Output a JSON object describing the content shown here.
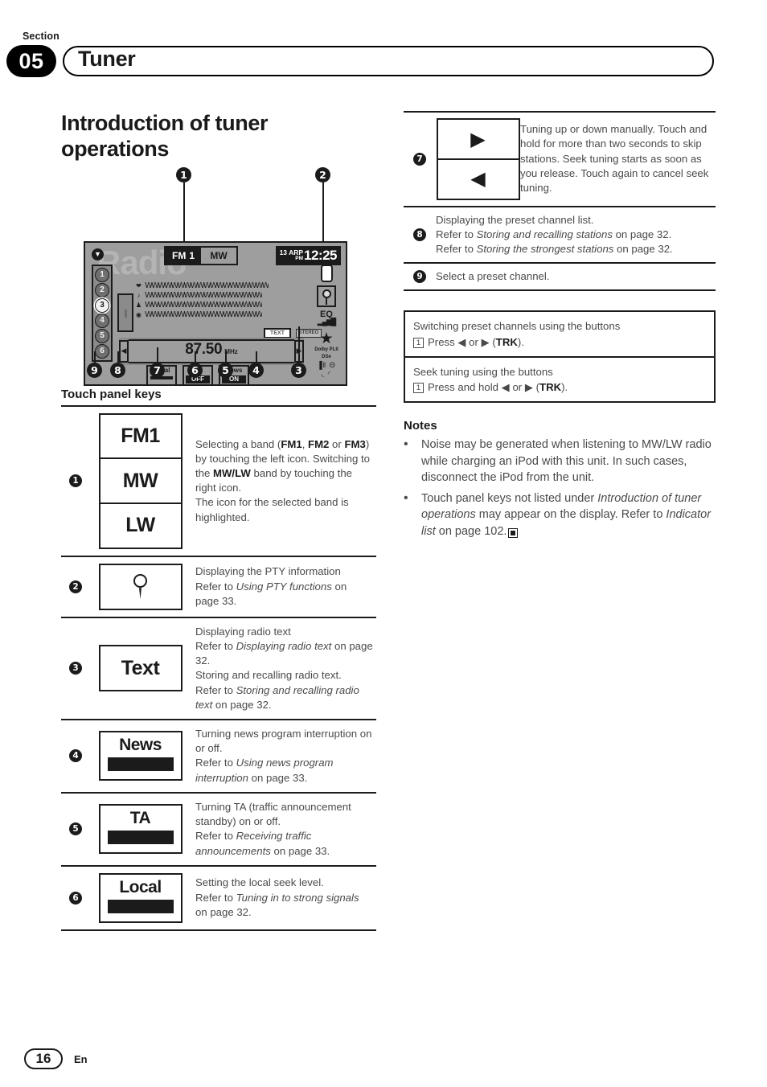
{
  "header": {
    "section_label": "Section",
    "section_number": "05",
    "title": "Tuner"
  },
  "page_heading": "Introduction of tuner operations",
  "diagram": {
    "callouts": [
      "1",
      "2",
      "3",
      "4",
      "5",
      "6",
      "7",
      "8",
      "9"
    ],
    "watermark": "Radio",
    "chevron_icon": "chevron-down-icon",
    "band": {
      "fm_label": "FM",
      "fm_number": "1",
      "mw_label": "MW"
    },
    "clock": {
      "date": "13 ARP",
      "meridiem": "PM",
      "time": "12:25"
    },
    "presets": [
      "1",
      "2",
      "3",
      "4",
      "5",
      "6"
    ],
    "preset_selected": "3",
    "text_lines": [
      "WWWWWWWWWWWWWWWWWWW",
      "WWWWWWWWWWWWWWWWWW",
      "WWWWWWWWWWWWWWWWWW",
      "WWWWWWWWWWWWWWWWWW"
    ],
    "text_line_icons": [
      "heart-icon",
      "note-icon",
      "artist-icon",
      "disc-icon"
    ],
    "frequency": "87.50",
    "frequency_unit": "MHz",
    "left_arrow": "◀",
    "right_arrow": "▶",
    "toggles": [
      {
        "label": "Local",
        "state": "———"
      },
      {
        "label": "TA",
        "state": "OFF"
      },
      {
        "label": "News",
        "state": "ON"
      }
    ],
    "indicator_text": "TEXT",
    "indicator_stereo": "STEREO",
    "rail": {
      "eq": "EQ",
      "bars": "▂▄▆█",
      "star": "★",
      "dolby": "Dolby PLII",
      "dsp": "DSe",
      "signal": "▐‖",
      "bluetooth": "Θ",
      "car_icons": "◟ ◜"
    }
  },
  "touch_panel_keys_title": "Touch panel keys",
  "key_rows": [
    {
      "num": "1",
      "buttons": [
        "FM1",
        "MW",
        "LW"
      ],
      "desc_html": "Selecting a band (<b>FM1</b>, <b>FM2</b> or <b>FM3</b>) by touching the left icon. Switching to the <b>MW/LW</b> band by touching the right icon.<br>The icon for the selected band is highlighted."
    },
    {
      "num": "2",
      "icon": "pty-pin-icon",
      "desc_html": "Displaying the PTY information<br>Refer to <i>Using PTY functions</i> on page 33."
    },
    {
      "num": "3",
      "buttons": [
        "Text"
      ],
      "desc_html": "Displaying radio text<br>Refer to <i>Displaying radio text</i> on page 32.<br>Storing and recalling radio text.<br>Refer to <i>Storing and recalling radio text</i> on page 32."
    },
    {
      "num": "4",
      "split_button": "News",
      "desc_html": "Turning news program interruption on or off.<br>Refer to <i>Using news program interruption</i> on page 33."
    },
    {
      "num": "5",
      "split_button": "TA",
      "desc_html": "Turning TA (traffic announcement standby) on or off.<br>Refer to <i>Receiving traffic announcements</i> on page 33."
    },
    {
      "num": "6",
      "split_button": "Local",
      "desc_html": "Setting the local seek level.<br>Refer to <i>Tuning in to strong signals</i> on page 32."
    }
  ],
  "right_rows": [
    {
      "num": "7",
      "arrows": [
        "▶",
        "◀"
      ],
      "desc_html": "Tuning up or down manually. Touch and hold for more than two seconds to skip stations. Seek tuning starts as soon as you release. Touch again to cancel seek tuning."
    },
    {
      "num": "8",
      "desc_html": "Displaying the preset channel list.<br>Refer to <i>Storing and recalling stations</i> on page 32.<br>Refer to <i>Storing the strongest stations</i> on page 32."
    },
    {
      "num": "9",
      "desc_html": "Select a preset channel."
    }
  ],
  "step_boxes": [
    {
      "title": "Switching preset channels using the buttons",
      "step_num": "1",
      "step_html": "Press ◀ or ▶ (<b>TRK</b>)."
    },
    {
      "title": "Seek tuning using the buttons",
      "step_num": "1",
      "step_html": "Press and hold ◀ or ▶ (<b>TRK</b>)."
    }
  ],
  "notes_title": "Notes",
  "notes": [
    {
      "html": "Noise may be generated when listening to MW/LW radio while charging an iPod with this unit. In such cases, disconnect the iPod from the unit.",
      "endmark": false
    },
    {
      "html": "Touch panel keys not listed under <i>Introduction of tuner operations</i> may appear on the display. Refer to <i>Indicator list</i> on page 102.",
      "endmark": true
    }
  ],
  "footer": {
    "page_number": "16",
    "language": "En"
  }
}
